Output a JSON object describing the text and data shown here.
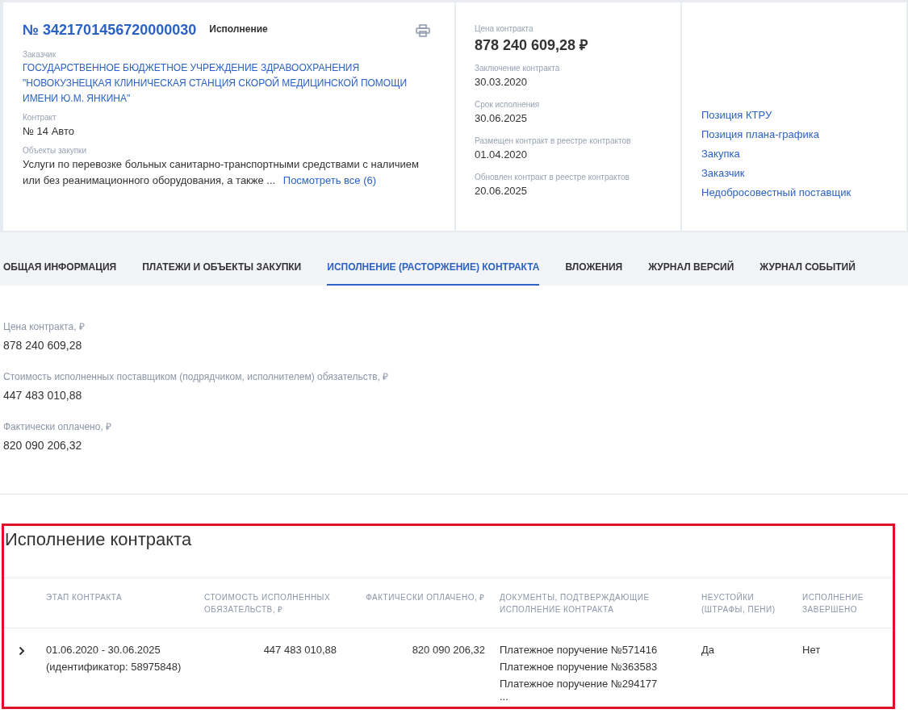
{
  "header": {
    "number": "№ 3421701456720000030",
    "status": "Исполнение",
    "customer": {
      "label": "Заказчик",
      "value": "ГОСУДАРСТВЕННОЕ БЮДЖЕТНОЕ УЧРЕЖДЕНИЕ ЗДРАВООХРАНЕНИЯ \"НОВОКУЗНЕЦКАЯ КЛИНИЧЕСКАЯ СТАНЦИЯ СКОРОЙ МЕДИЦИНСКОЙ ПОМОЩИ ИМЕНИ Ю.М. ЯНКИНА\""
    },
    "contract": {
      "label": "Контракт",
      "value": "№ 14 Авто"
    },
    "objects": {
      "label": "Объекты закупки",
      "value": "Услуги по перевозке больных санитарно-транспортными средствами с наличием или без реанимационного оборудования, а также ...",
      "more_link": "Посмотреть все (6)"
    }
  },
  "summary": {
    "price": {
      "label": "Цена контракта",
      "value": "878 240 609,28 ₽"
    },
    "dates": [
      {
        "label": "Заключение контракта",
        "value": "30.03.2020"
      },
      {
        "label": "Срок исполнения",
        "value": "30.06.2025"
      },
      {
        "label": "Размещен контракт в реестре контрактов",
        "value": "01.04.2020"
      },
      {
        "label": "Обновлен контракт в реестре контрактов",
        "value": "20.06.2025"
      }
    ]
  },
  "links": [
    "Позиция КТРУ",
    "Позиция плана-графика",
    "Закупка",
    "Заказчик",
    "Недобросовестный поставщик"
  ],
  "tabs": [
    {
      "label": "ОБЩАЯ ИНФОРМАЦИЯ",
      "selected": false
    },
    {
      "label": "ПЛАТЕЖИ И ОБЪЕКТЫ ЗАКУПКИ",
      "selected": false
    },
    {
      "label": "ИСПОЛНЕНИЕ (РАСТОРЖЕНИЕ) КОНТРАКТА",
      "selected": true
    },
    {
      "label": "ВЛОЖЕНИЯ",
      "selected": false
    },
    {
      "label": "ЖУРНАЛ ВЕРСИЙ",
      "selected": false
    },
    {
      "label": "ЖУРНАЛ СОБЫТИЙ",
      "selected": false
    }
  ],
  "fields": [
    {
      "label": "Цена контракта, ₽",
      "value": "878 240 609,28"
    },
    {
      "label": "Стоимость исполненных поставщиком (подрядчиком, исполнителем) обязательств, ₽",
      "value": "447 483 010,88"
    },
    {
      "label": "Фактически оплачено, ₽",
      "value": "820 090 206,32"
    }
  ],
  "execution": {
    "title": "Исполнение контракта",
    "columns": [
      "ЭТАП КОНТРАКТА",
      "СТОИМОСТЬ ИСПОЛНЕННЫХ ОБЯЗАТЕЛЬСТВ, ₽",
      "ФАКТИЧЕСКИ ОПЛАЧЕНО, ₽",
      "ДОКУМЕНТЫ, ПОДТВЕРЖДАЮЩИЕ ИСПОЛНЕНИЕ КОНТРАКТА",
      "НЕУСТОЙКИ (ШТРАФЫ, ПЕНИ)",
      "ИСПОЛНЕНИЕ ЗАВЕРШЕНО"
    ],
    "rows": [
      {
        "expanded": false,
        "stage": [
          "01.06.2020 - 30.06.2025",
          "(идентификатор: 58975848)"
        ],
        "cost": "447 483 010,88",
        "paid": "820 090 206,32",
        "documents": [
          "Платежное поручение №571416",
          "Платежное поручение №363583",
          "Платежное поручение №294177",
          "..."
        ],
        "penalties": "Да",
        "completed": "Нет"
      }
    ]
  }
}
